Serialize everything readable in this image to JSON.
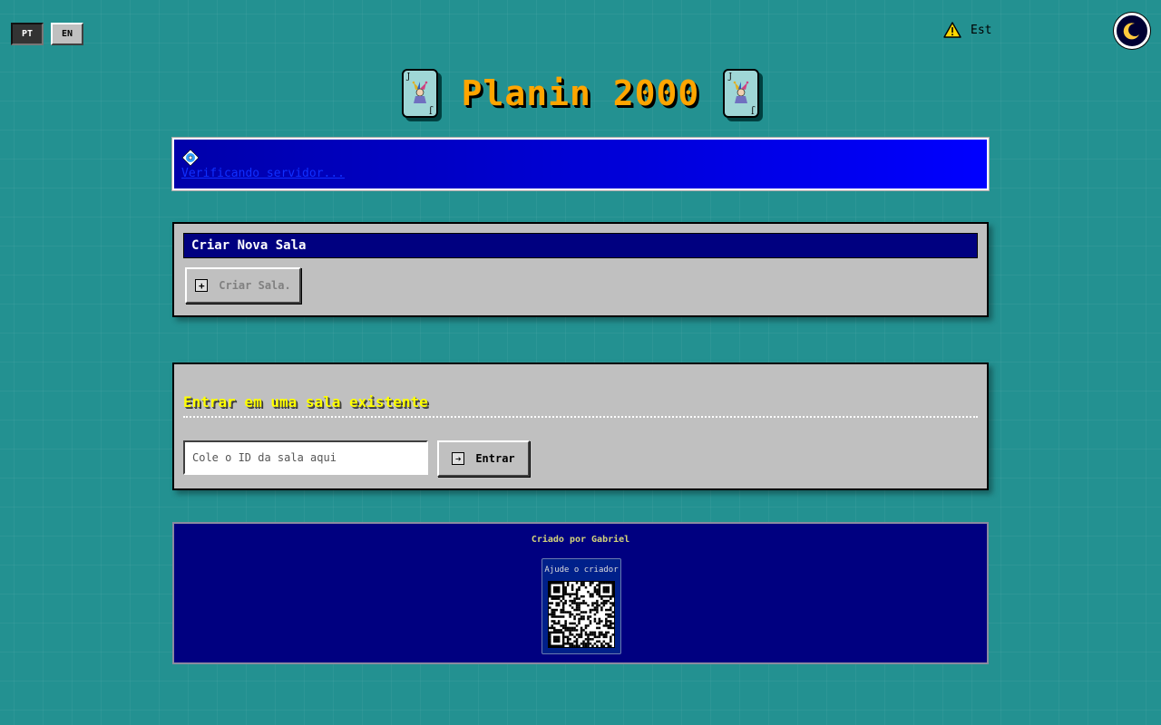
{
  "language": {
    "options": [
      {
        "code": "PT",
        "active": true
      },
      {
        "code": "EN",
        "active": false
      }
    ]
  },
  "status": {
    "icon": "warning-icon",
    "text": "Est"
  },
  "theme_toggle": {
    "icon": "moon-icon"
  },
  "header": {
    "title": "Planin 2000",
    "card_icon": "joker-card-icon",
    "card_corner": "J"
  },
  "server_banner": {
    "icon": "cd-icon",
    "text": "Verificando servidor..."
  },
  "create_panel": {
    "title": "Criar Nova Sala",
    "button_label": "Criar Sala.",
    "button_icon": "plus-icon"
  },
  "join_panel": {
    "heading": "Entrar em uma sala existente",
    "input_placeholder": "Cole o ID da sala aqui",
    "input_value": "",
    "button_label": "Entrar",
    "button_icon": "arrow-right-icon"
  },
  "footer": {
    "credit": "Criado por Gabriel",
    "donate_label": "Ajude o criador",
    "qr_icon": "qr-code-icon"
  },
  "colors": {
    "desktop": "#008080",
    "titlebar": "#000080",
    "window": "#c0c0c0",
    "title_text": "#ffa500",
    "heading_text": "#ffff00"
  }
}
